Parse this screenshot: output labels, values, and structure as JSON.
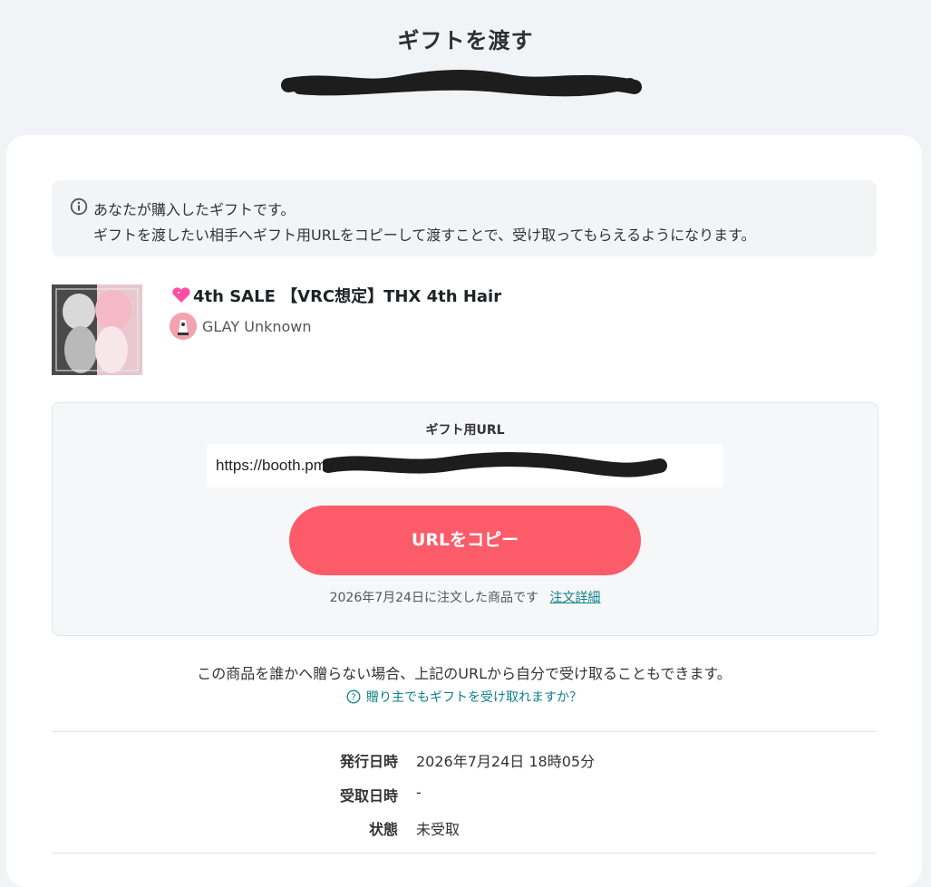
{
  "header": {
    "title": "ギフトを渡す"
  },
  "notice": {
    "icon": "info-icon",
    "line1": "あなたが購入したギフトです。",
    "line2": "ギフトを渡したい相手へギフト用URLをコピーして渡すことで、受け取ってもらえるようになります。"
  },
  "product": {
    "title": "4th SALE 【VRC想定】THX 4th Hair",
    "heart_color": "#ff4fa3",
    "shop_name": "GLAY Unknown"
  },
  "gift_url": {
    "label": "ギフト用URL",
    "value": "https://booth.pm",
    "copy_button": "URLをコピー",
    "order_text": "2026年7月24日に注文した商品です",
    "order_link": "注文詳細"
  },
  "self_receive": {
    "text": "この商品を誰かへ贈らない場合、上記のURLから自分で受け取ることもできます。",
    "help_link": "贈り主でもギフトを受け取れますか？"
  },
  "details": [
    {
      "label": "発行日時",
      "value": "2026年7月24日 18時05分"
    },
    {
      "label": "受取日時",
      "value": "-"
    },
    {
      "label": "状態",
      "value": "未受取"
    }
  ],
  "colors": {
    "accent": "#fc5c6a",
    "link": "#0e7f86",
    "background": "#f1f4f6"
  }
}
